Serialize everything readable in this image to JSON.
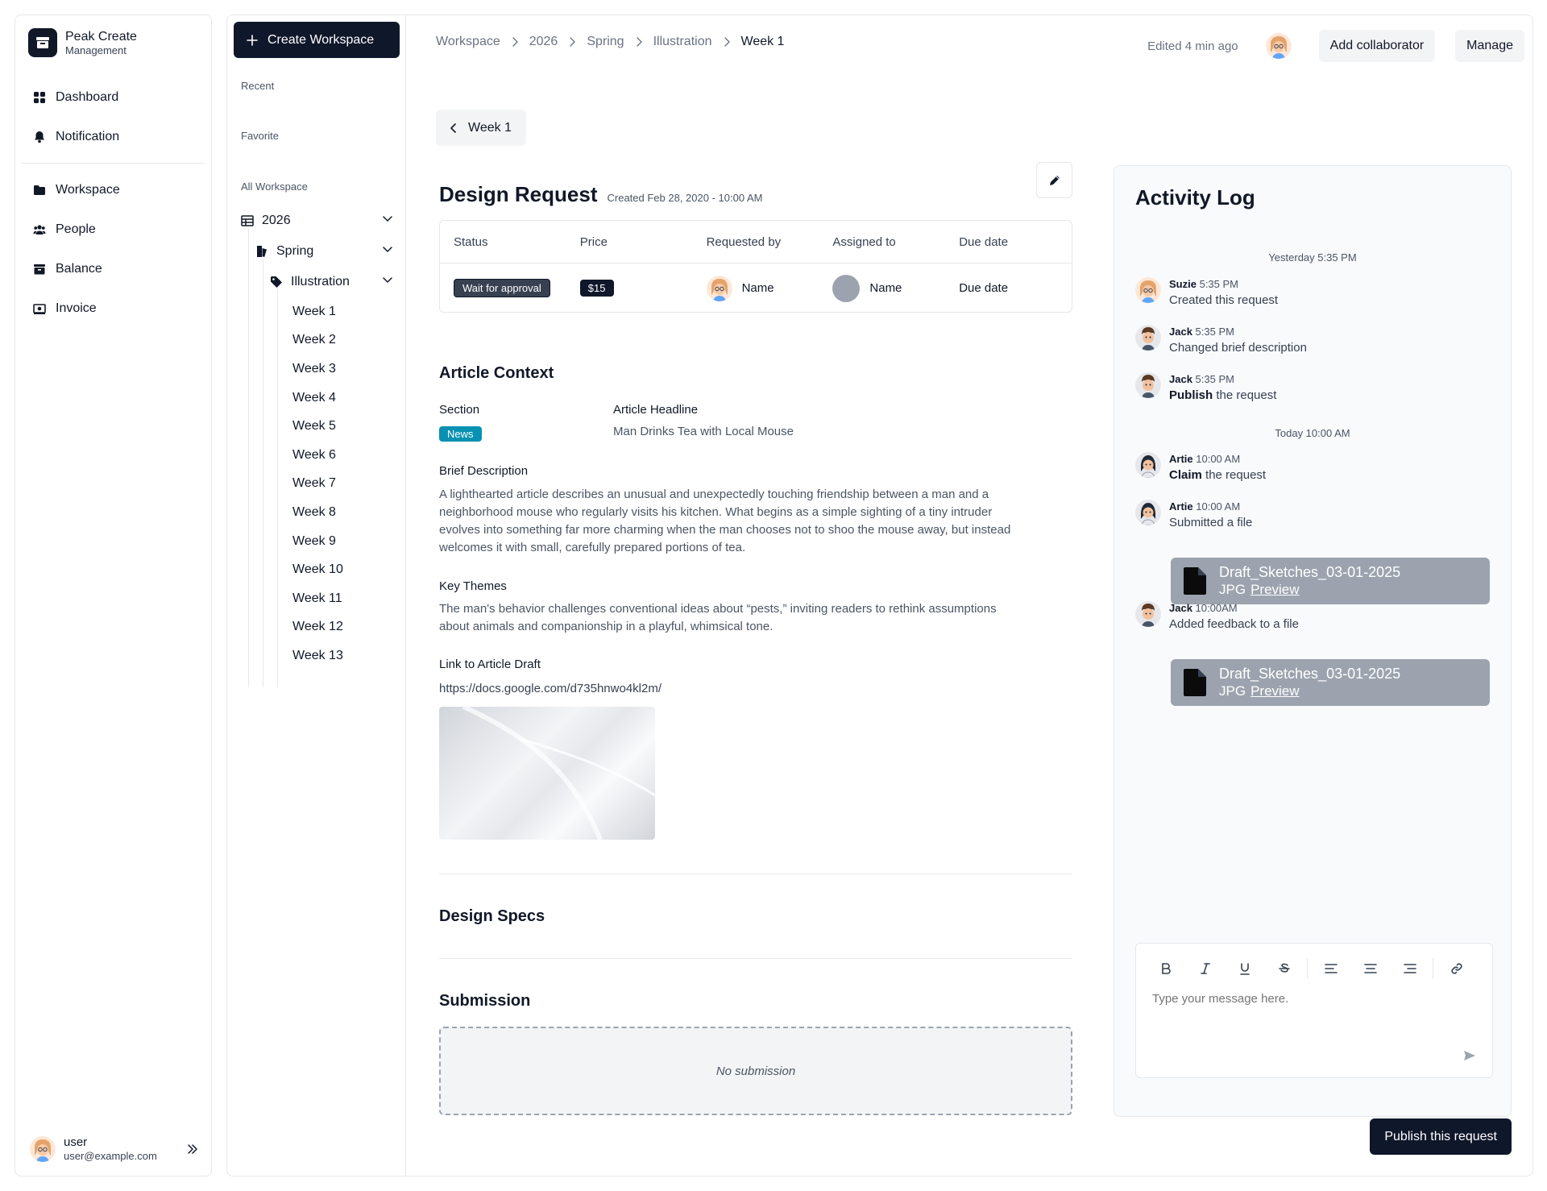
{
  "brand": {
    "name": "Peak Create",
    "subtitle": "Management"
  },
  "nav": {
    "dashboard": "Dashboard",
    "notification": "Notification",
    "workspace": "Workspace",
    "people": "People",
    "balance": "Balance",
    "invoice": "Invoice"
  },
  "user": {
    "name": "user",
    "email": "user@example.com"
  },
  "workspace_panel": {
    "create_label": "Create Workspace",
    "recent": "Recent",
    "favorite": "Favorite",
    "all": "All Workspace",
    "year": "2026",
    "season": "Spring",
    "category": "Illustration",
    "weeks": [
      "Week 1",
      "Week 2",
      "Week 3",
      "Week 4",
      "Week 5",
      "Week 6",
      "Week 7",
      "Week 8",
      "Week 9",
      "Week 10",
      "Week 11",
      "Week 12",
      "Week 13"
    ]
  },
  "breadcrumb": [
    "Workspace",
    "2026",
    "Spring",
    "Illustration",
    "Week 1"
  ],
  "header": {
    "edited": "Edited 4 min ago",
    "add_collaborator": "Add collaborator",
    "manage": "Manage"
  },
  "back_label": "Week 1",
  "request": {
    "title": "Design Request",
    "created": "Created Feb 28, 2020 - 10:00 AM",
    "columns": [
      "Status",
      "Price",
      "Requested by",
      "Assigned to",
      "Due date"
    ],
    "status": "Wait for approval",
    "price": "$15",
    "requested_by": "Name",
    "assigned_to": "Name",
    "due_date": "Due date"
  },
  "article": {
    "heading": "Article Context",
    "section_label": "Section",
    "section_value": "News",
    "headline_label": "Article Headline",
    "headline_value": "Man Drinks Tea with Local Mouse",
    "brief_label": "Brief Description",
    "brief_lines": [
      "A lighthearted article describes an unusual and unexpectedly touching friendship between a man and a",
      "neighborhood mouse who regularly visits his kitchen. What begins as a simple sighting of a tiny intruder",
      "evolves into something far more charming when the man chooses not to shoo the mouse away, but instead",
      "welcomes it with small, carefully prepared portions of tea."
    ],
    "themes_label": "Key Themes",
    "themes_lines": [
      "The man's behavior challenges conventional ideas about “pests,” inviting readers to rethink assumptions",
      "about animals and companionship in a playful, whimsical tone."
    ],
    "link_label": "Link to Article Draft",
    "link_url": "https://docs.google.com/d735hnwo4kl2m/"
  },
  "design_specs": "Design Specs",
  "submission": {
    "heading": "Submission",
    "empty": "No submission"
  },
  "activity": {
    "title": "Activity Log",
    "yesterday": "Yesterday 5:35 PM",
    "today": "Today 10:00 AM",
    "entries": [
      {
        "name": "Suzie",
        "time": "5:35 PM",
        "text": "Created this request"
      },
      {
        "name": "Jack",
        "time": "5:35 PM",
        "text": "Changed brief description"
      },
      {
        "name": "Jack",
        "time": "5:35 PM",
        "bold": "Publish",
        "text": " the request"
      },
      {
        "name": "Artie",
        "time": "10:00 AM",
        "bold": "Claim",
        "text": " the request"
      },
      {
        "name": "Artie",
        "time": "10:00 AM",
        "text": "Submitted a file"
      },
      {
        "name": "Jack",
        "time": "10:00AM",
        "text": "Added feedback to a file"
      }
    ],
    "file": {
      "name": "Draft_Sketches_03-01-2025",
      "type": "JPG",
      "preview": "Preview"
    },
    "composer_placeholder": "Type your message here."
  },
  "publish_label": "Publish this request",
  "colors": {
    "primary": "#0f172a",
    "news": "#0891b2",
    "file_card": "#9ca3af"
  }
}
